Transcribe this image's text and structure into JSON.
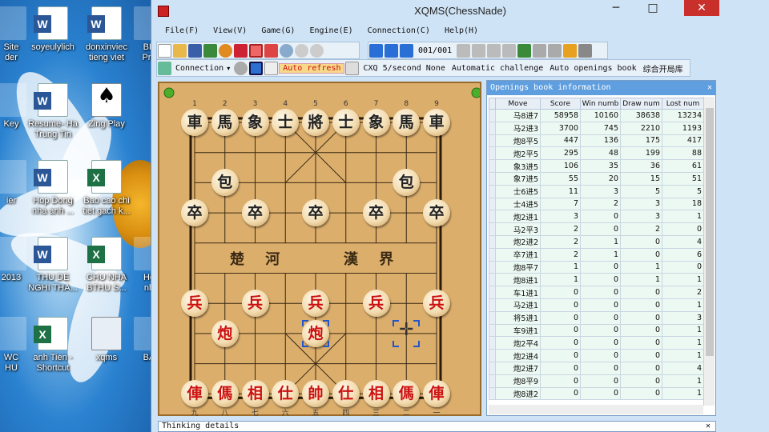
{
  "desktop": {
    "icons": [
      {
        "label": "Site\nder",
        "kind": "folder"
      },
      {
        "label": "soyeulylich",
        "kind": "word"
      },
      {
        "label": "donxinviec\ntieng viet",
        "kind": "word"
      },
      {
        "label": "BB\nPro",
        "kind": "other"
      },
      {
        "label": "Resume- Ha\nTrung Tin",
        "kind": "word"
      },
      {
        "label": "Zing Play",
        "kind": "game"
      },
      {
        "label": "Key",
        "kind": "other"
      },
      {
        "label": "Hop Dong\nnha anh ...",
        "kind": "word"
      },
      {
        "label": "Bao cao chi\ntiet gach k...",
        "kind": "excel"
      },
      {
        "label": "ier",
        "kind": "other"
      },
      {
        "label": "2013",
        "kind": "other"
      },
      {
        "label": "THU DE\nNGHI THA...",
        "kind": "word"
      },
      {
        "label": "CHU NHA\nBTHU S...",
        "kind": "excel"
      },
      {
        "label": "Ho\nnh",
        "kind": "other"
      },
      {
        "label": "WC\nHU",
        "kind": "other"
      },
      {
        "label": "anh Tien -\nShortcut",
        "kind": "excel"
      },
      {
        "label": "xqms",
        "kind": "file"
      },
      {
        "label": "BA",
        "kind": "other"
      }
    ]
  },
  "window": {
    "title": "XQMS(ChessNade)",
    "minimize": "─",
    "maximize": "□",
    "close": "✕"
  },
  "menu": [
    "File(F)",
    "View(V)",
    "Game(G)",
    "Engine(E)",
    "Connection(C)",
    "Help(H)"
  ],
  "toolbar": {
    "move_counter": "001/001",
    "connection_label": "Connection",
    "auto_refresh": "Auto refresh",
    "cxq_status": "CXQ 5/second None",
    "auto_challenge": "Automatic challenge",
    "auto_openings": "Auto openings book",
    "chinese_label": "综合开局库"
  },
  "board": {
    "top_files": [
      "1",
      "2",
      "3",
      "4",
      "5",
      "6",
      "7",
      "8",
      "9"
    ],
    "bottom_files": [
      "九",
      "八",
      "七",
      "六",
      "五",
      "四",
      "三",
      "二",
      "一"
    ],
    "river_left": "楚 河",
    "river_right": "漢 界",
    "pieces": [
      {
        "ch": "車",
        "side": "b",
        "f": 0,
        "r": 0
      },
      {
        "ch": "馬",
        "side": "b",
        "f": 1,
        "r": 0
      },
      {
        "ch": "象",
        "side": "b",
        "f": 2,
        "r": 0
      },
      {
        "ch": "士",
        "side": "b",
        "f": 3,
        "r": 0
      },
      {
        "ch": "將",
        "side": "b",
        "f": 4,
        "r": 0
      },
      {
        "ch": "士",
        "side": "b",
        "f": 5,
        "r": 0
      },
      {
        "ch": "象",
        "side": "b",
        "f": 6,
        "r": 0
      },
      {
        "ch": "馬",
        "side": "b",
        "f": 7,
        "r": 0
      },
      {
        "ch": "車",
        "side": "b",
        "f": 8,
        "r": 0
      },
      {
        "ch": "包",
        "side": "b",
        "f": 1,
        "r": 2
      },
      {
        "ch": "包",
        "side": "b",
        "f": 7,
        "r": 2
      },
      {
        "ch": "卒",
        "side": "b",
        "f": 0,
        "r": 3
      },
      {
        "ch": "卒",
        "side": "b",
        "f": 2,
        "r": 3
      },
      {
        "ch": "卒",
        "side": "b",
        "f": 4,
        "r": 3
      },
      {
        "ch": "卒",
        "side": "b",
        "f": 6,
        "r": 3
      },
      {
        "ch": "卒",
        "side": "b",
        "f": 8,
        "r": 3
      },
      {
        "ch": "兵",
        "side": "r",
        "f": 0,
        "r": 6
      },
      {
        "ch": "兵",
        "side": "r",
        "f": 2,
        "r": 6
      },
      {
        "ch": "兵",
        "side": "r",
        "f": 4,
        "r": 6
      },
      {
        "ch": "兵",
        "side": "r",
        "f": 6,
        "r": 6
      },
      {
        "ch": "兵",
        "side": "r",
        "f": 8,
        "r": 6
      },
      {
        "ch": "炮",
        "side": "r",
        "f": 1,
        "r": 7
      },
      {
        "ch": "炮",
        "side": "r",
        "f": 4,
        "r": 7
      },
      {
        "ch": "俥",
        "side": "r",
        "f": 0,
        "r": 9
      },
      {
        "ch": "傌",
        "side": "r",
        "f": 1,
        "r": 9
      },
      {
        "ch": "相",
        "side": "r",
        "f": 2,
        "r": 9
      },
      {
        "ch": "仕",
        "side": "r",
        "f": 3,
        "r": 9
      },
      {
        "ch": "帥",
        "side": "r",
        "f": 4,
        "r": 9
      },
      {
        "ch": "仕",
        "side": "r",
        "f": 5,
        "r": 9
      },
      {
        "ch": "相",
        "side": "r",
        "f": 6,
        "r": 9
      },
      {
        "ch": "傌",
        "side": "r",
        "f": 7,
        "r": 9
      },
      {
        "ch": "俥",
        "side": "r",
        "f": 8,
        "r": 9
      }
    ],
    "selection_from": {
      "f": 4,
      "r": 7
    },
    "selection_to": {
      "f": 7,
      "r": 7
    }
  },
  "book": {
    "title": "Openings book information",
    "columns": [
      "Move",
      "Score",
      "Win numb",
      "Draw num",
      "Lost num"
    ],
    "rows": [
      [
        "马8进7",
        "58958",
        "10160",
        "38638",
        "13234"
      ],
      [
        "马2进3",
        "3700",
        "745",
        "2210",
        "1193"
      ],
      [
        "炮8平5",
        "447",
        "136",
        "175",
        "417"
      ],
      [
        "炮2平5",
        "295",
        "48",
        "199",
        "88"
      ],
      [
        "象3进5",
        "106",
        "35",
        "36",
        "61"
      ],
      [
        "象7进5",
        "55",
        "20",
        "15",
        "51"
      ],
      [
        "士6进5",
        "11",
        "3",
        "5",
        "5"
      ],
      [
        "士4进5",
        "7",
        "2",
        "3",
        "18"
      ],
      [
        "炮2进1",
        "3",
        "0",
        "3",
        "1"
      ],
      [
        "马2平3",
        "2",
        "0",
        "2",
        "0"
      ],
      [
        "炮2进2",
        "2",
        "1",
        "0",
        "4"
      ],
      [
        "卒7进1",
        "2",
        "1",
        "0",
        "6"
      ],
      [
        "炮8平7",
        "1",
        "0",
        "1",
        "0"
      ],
      [
        "炮8进1",
        "1",
        "0",
        "1",
        "1"
      ],
      [
        "车1进1",
        "0",
        "0",
        "0",
        "2"
      ],
      [
        "马2进1",
        "0",
        "0",
        "0",
        "1"
      ],
      [
        "将5进1",
        "0",
        "0",
        "0",
        "3"
      ],
      [
        "车9进1",
        "0",
        "0",
        "0",
        "1"
      ],
      [
        "炮2平4",
        "0",
        "0",
        "0",
        "1"
      ],
      [
        "炮2进4",
        "0",
        "0",
        "0",
        "1"
      ],
      [
        "炮2进7",
        "0",
        "0",
        "0",
        "4"
      ],
      [
        "炮8平9",
        "0",
        "0",
        "0",
        "1"
      ],
      [
        "炮8进2",
        "0",
        "0",
        "0",
        "1"
      ]
    ]
  },
  "thinking": {
    "title": "Thinking details",
    "close": "✕"
  }
}
